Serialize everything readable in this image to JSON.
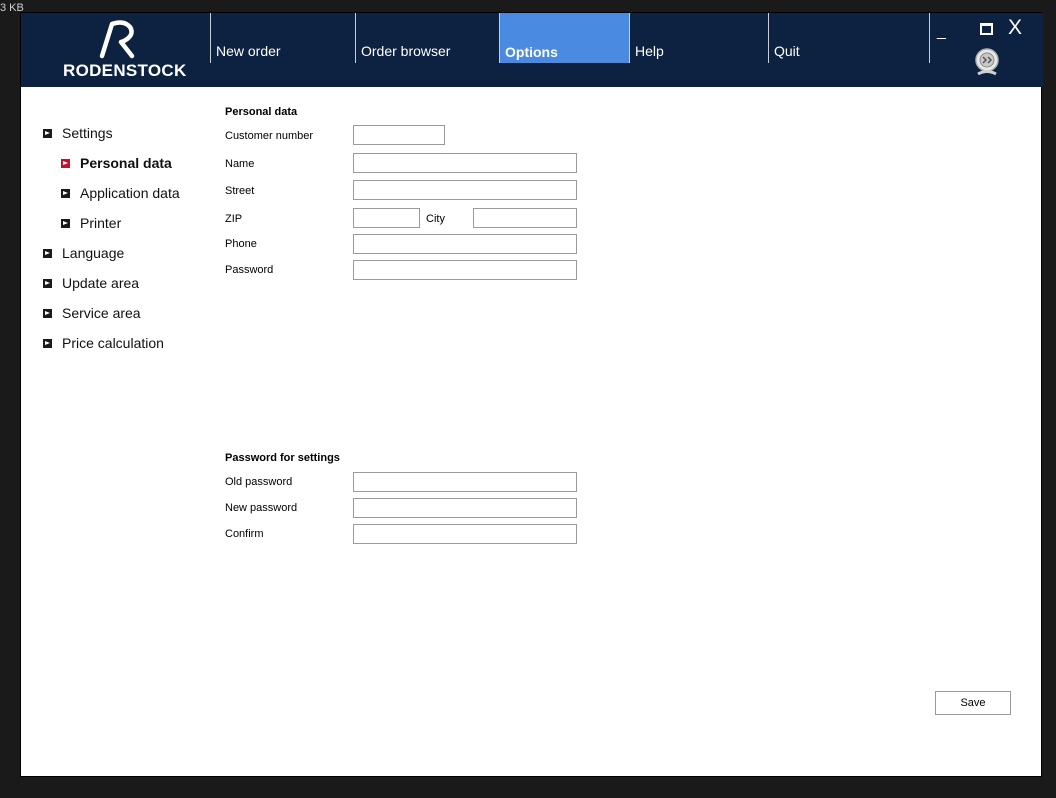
{
  "corner_text": "3 KB",
  "brand": {
    "name": "RODENSTOCK"
  },
  "nav": {
    "items": [
      {
        "label": "New order"
      },
      {
        "label": "Order browser"
      },
      {
        "label": "Options"
      },
      {
        "label": "Help"
      },
      {
        "label": "Quit"
      }
    ],
    "active_index": 2,
    "active_color": "#4a8ae0",
    "bar_color": "#0c2240"
  },
  "window_controls": {
    "minimize": "_",
    "close": "X"
  },
  "sidebar": {
    "items": [
      {
        "label": "Settings",
        "level": 0
      },
      {
        "label": "Personal data",
        "level": 1,
        "current": true
      },
      {
        "label": "Application data",
        "level": 1
      },
      {
        "label": "Printer",
        "level": 1
      },
      {
        "label": "Language",
        "level": 0
      },
      {
        "label": "Update area",
        "level": 0
      },
      {
        "label": "Service area",
        "level": 0
      },
      {
        "label": "Price calculation",
        "level": 0
      }
    ]
  },
  "personal_data": {
    "title": "Personal data",
    "customer_number": {
      "label": "Customer number",
      "value": ""
    },
    "name": {
      "label": "Name",
      "value": ""
    },
    "street": {
      "label": "Street",
      "value": ""
    },
    "zip": {
      "label": "ZIP",
      "value": ""
    },
    "city": {
      "label": "City",
      "value": ""
    },
    "phone": {
      "label": "Phone",
      "value": ""
    },
    "password": {
      "label": "Password",
      "value": ""
    }
  },
  "password_settings": {
    "title": "Password for settings",
    "old_password": {
      "label": "Old password",
      "value": ""
    },
    "new_password": {
      "label": "New password",
      "value": ""
    },
    "confirm": {
      "label": "Confirm",
      "value": ""
    }
  },
  "actions": {
    "save_label": "Save"
  }
}
